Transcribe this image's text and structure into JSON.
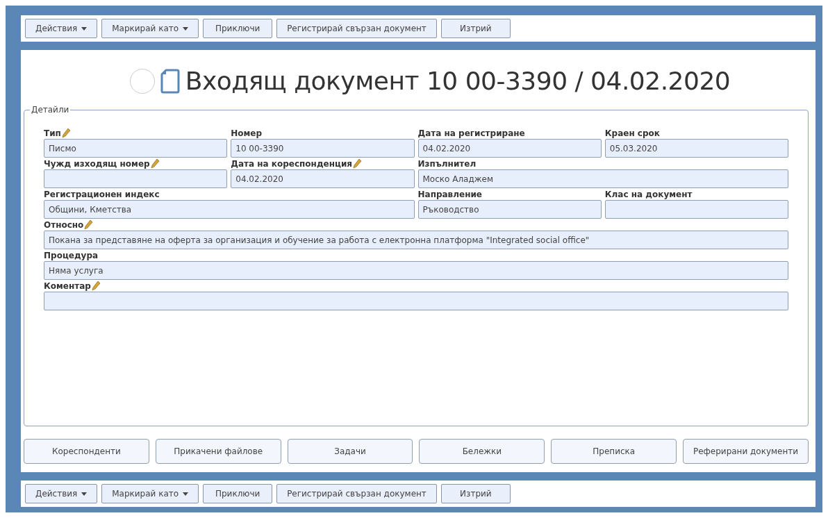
{
  "top_toolbar": [
    {
      "label": "Действия",
      "dropdown": true
    },
    {
      "label": "Маркирай като",
      "dropdown": true
    },
    {
      "label": "Приключи",
      "dropdown": false
    },
    {
      "label": "Регистрирай свързан документ",
      "dropdown": false
    },
    {
      "label": "Изтрий",
      "dropdown": false
    }
  ],
  "title": {
    "text": "Входящ документ 10 00-3390 / 04.02.2020",
    "done": false
  },
  "details": {
    "legend": "Детайли",
    "fields": [
      {
        "label": "Тип",
        "editable": true,
        "value": "Писмо",
        "kind": "single"
      },
      {
        "label": "Номер",
        "editable": false,
        "value": "10 00-3390",
        "kind": "single"
      },
      {
        "label": "Дата на регистриране",
        "editable": false,
        "value": "04.02.2020",
        "kind": "single"
      },
      {
        "label": "Краен срок",
        "editable": false,
        "value": "05.03.2020",
        "kind": "single"
      },
      {
        "label": "Чужд изходящ номер",
        "editable": true,
        "kind": "single"
      },
      {
        "label": "Дата на кореспонденция",
        "editable": true,
        "value": "04.02.2020",
        "kind": "single"
      },
      {
        "label": "Изпълнител",
        "editable": false,
        "value": "Моско Аладжем",
        "kind": "double"
      },
      {
        "label": "Регистрационен индекс",
        "editable": false,
        "value": "Общини, Кметства",
        "kind": "double"
      },
      {
        "label": "Направление",
        "editable": false,
        "value": "Ръководство",
        "kind": "single"
      },
      {
        "label": "Клас на документ",
        "editable": false,
        "kind": "single"
      },
      {
        "label": "Относно",
        "editable": true,
        "value": "Покана за представяне на оферта за организация и обучение за работа с електронна платформа \"Integrated social office\"",
        "kind": "full"
      },
      {
        "label": "Процедура",
        "editable": false,
        "value": "Няма услуга",
        "kind": "full"
      },
      {
        "label": "Коментар",
        "editable": true,
        "kind": "full"
      }
    ]
  },
  "section_buttons": [
    "Кореспонденти",
    "Прикачени файлове",
    "Задачи",
    "Бележки",
    "Преписка",
    "Реферирани документи"
  ],
  "bottom_toolbar": [
    {
      "label": "Действия",
      "dropdown": true
    },
    {
      "label": "Маркирай като",
      "dropdown": true
    },
    {
      "label": "Приключи",
      "dropdown": false
    },
    {
      "label": "Регистрирай свързан документ",
      "dropdown": false
    },
    {
      "label": "Изтрий",
      "dropdown": false
    }
  ]
}
